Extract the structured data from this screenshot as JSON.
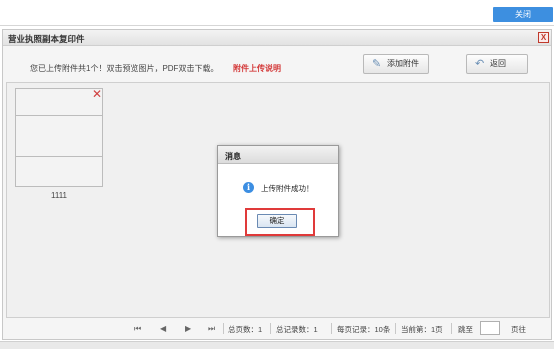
{
  "topbar": {
    "close_label": "关闭"
  },
  "panel": {
    "title": "营业执照副本复印件",
    "close_glyph": "X",
    "info_text": "您已上传附件共1个！双击预览图片，PDF双击下载。",
    "upload_note": "附件上传说明",
    "add_attachment_label": "添加附件",
    "back_label": "返回"
  },
  "attachments": [
    {
      "label": "1111"
    }
  ],
  "dialog": {
    "title": "消息",
    "message": "上传附件成功！",
    "ok_label": "确定"
  },
  "pager": {
    "first": "⏮",
    "prev": "◀",
    "next": "▶",
    "last": "⏭",
    "total_pages": "总页数：1",
    "total_records": "总记录数：1",
    "per_page": "每页记录：10条",
    "current_page": "当前第：1页",
    "jump_to": "跳至",
    "page_suffix": "页往"
  },
  "colors": {
    "accent": "#3d8fe0",
    "alert": "#d43b3b",
    "highlight": "#e03a3a"
  }
}
